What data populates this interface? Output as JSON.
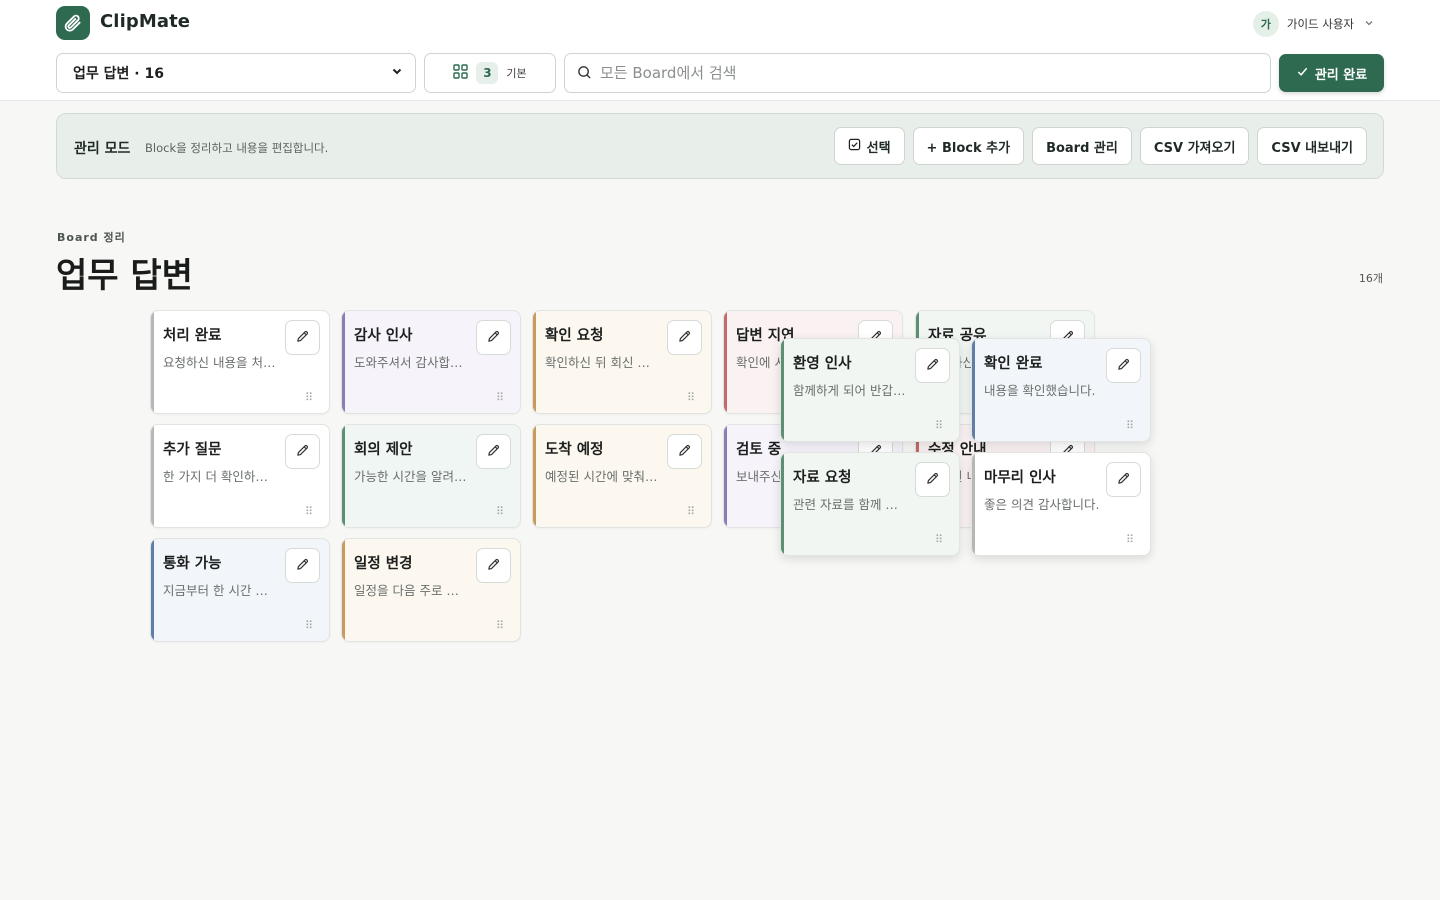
{
  "app": {
    "brand": "ClipMate",
    "user": {
      "avatar_initial": "가",
      "name": "가이드 사용자"
    }
  },
  "toolbar": {
    "board_select_value": "업무 답변 · 16",
    "layout_count": "3",
    "layout_label": "기본",
    "search_placeholder": "모든 Board에서 검색",
    "done_label": "관리 완료"
  },
  "admin": {
    "title": "관리 모드",
    "description": "Block을 정리하고 내용을 편집합니다.",
    "actions": [
      {
        "label": "선택"
      },
      {
        "label": "+ Block 추가"
      },
      {
        "label": "Board 관리"
      },
      {
        "label": "CSV 가져오기"
      },
      {
        "label": "CSV 내보내기"
      }
    ]
  },
  "board": {
    "eyebrow": "Board 정리",
    "title": "업무 답변",
    "count_label": "16개"
  },
  "colors": {
    "accent": "#2d6a4f",
    "gray": "#b5b8b6",
    "purple": "#8c7db3",
    "orange": "#c9995f",
    "red": "#c46a6a",
    "green": "#5f8f72",
    "blue": "#5f7fa6"
  },
  "blocks": [
    {
      "title": "처리 완료",
      "body": "요청하신 내용을 처리했습니다.",
      "color": "#b5b8b6",
      "bg": "#ffffff"
    },
    {
      "title": "감사 인사",
      "body": "도와주셔서 감사합니다.",
      "color": "#8c7db3",
      "bg": "#f6f3fa"
    },
    {
      "title": "확인 요청",
      "body": "확인하신 뒤 회신 부탁드립니다.",
      "color": "#c9995f",
      "bg": "#fcf8ef"
    },
    {
      "title": "답변 지연",
      "body": "확인에 시간이 조금 걸립니다.",
      "color": "#c46a6a",
      "bg": "#faf2f2"
    },
    {
      "title": "자료 공유",
      "body": "요청하신 자료를 공유드립니다.",
      "color": "#5f8f72",
      "bg": "#f1f6f3"
    },
    {
      "title": "추가 질문",
      "body": "한 가지 더 확인하고 싶습니다.",
      "color": "#b5b8b6",
      "bg": "#ffffff"
    },
    {
      "title": "회의 제안",
      "body": "가능한 시간을 알려주세요.",
      "color": "#5f8f72",
      "bg": "#f0f6f3"
    },
    {
      "title": "도착 예정",
      "body": "예정된 시간에 맞춰 도착합니다.",
      "color": "#c9995f",
      "bg": "#fcf8ef"
    },
    {
      "title": "검토 중",
      "body": "보내주신 내용을 검토 중입니다.",
      "color": "#8c7db3",
      "bg": "#f6f3fa"
    },
    {
      "title": "수정 안내",
      "body": "수정된 내용을 안내드립니다.",
      "color": "#c46a6a",
      "bg": "#faf2f2"
    },
    {
      "title": "통화 가능",
      "body": "지금부터 한 시간 통화 가능합니다.",
      "color": "#5f7fa6",
      "bg": "#f2f6fa"
    },
    {
      "title": "일정 변경",
      "body": "일정을 다음 주로 변경하고 싶습니다.",
      "color": "#c9995f",
      "bg": "#fcf8ef"
    },
    {
      "title": "환영 인사",
      "body": "함께하게 되어 반갑습니다.",
      "color": "#5f8f72",
      "bg": "#f1f6f3"
    },
    {
      "title": "확인 완료",
      "body": "내용을 확인했습니다.",
      "color": "#5f7fa6",
      "bg": "#f2f6fa"
    },
    {
      "title": "자료 요청",
      "body": "관련 자료를 함께 보내주세요.",
      "color": "#5f8f72",
      "bg": "#f1f6f3"
    },
    {
      "title": "마무리 인사",
      "body": "좋은 의견 감사합니다.",
      "color": "#b5b8b6",
      "bg": "#ffffff"
    }
  ]
}
